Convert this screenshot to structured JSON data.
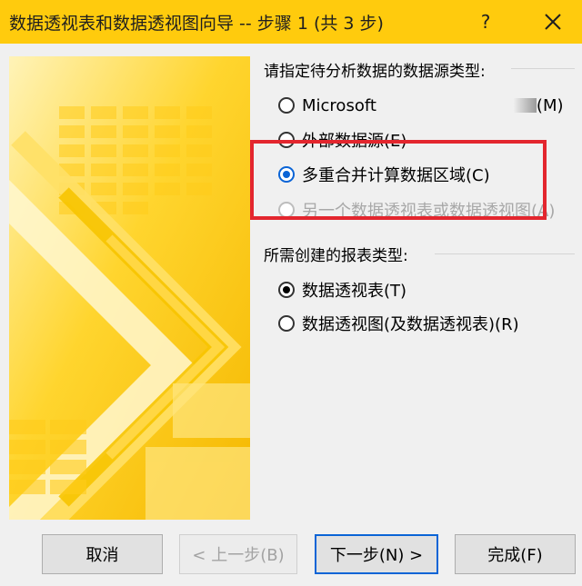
{
  "window": {
    "title": "数据透视表和数据透视图向导 -- 步骤 1 (共 3 步)",
    "help_label": "?",
    "close_icon": "close-icon",
    "titlebar_color": "#ffcb0d"
  },
  "source_group": {
    "label": "请指定待分析数据的数据源类型:",
    "options": [
      {
        "label": "Microsoft",
        "suffix": "(M)",
        "checked": false,
        "enabled": true
      },
      {
        "label": "外部数据源(E)",
        "checked": false,
        "enabled": true
      },
      {
        "label": "多重合并计算数据区域(C)",
        "checked": true,
        "enabled": true
      },
      {
        "label": "另一个数据透视表或数据透视图(A)",
        "checked": false,
        "enabled": false
      }
    ]
  },
  "report_group": {
    "label": "所需创建的报表类型:",
    "options": [
      {
        "label": "数据透视表(T)",
        "checked": true
      },
      {
        "label": "数据透视图(及数据透视表)(R)",
        "checked": false
      }
    ]
  },
  "buttons": {
    "cancel": "取消",
    "back": "< 上一步(B)",
    "next": "下一步(N) >",
    "finish": "完成(F)"
  },
  "accent_colors": {
    "highlight_box": "#e3262e",
    "selected_radio": "#0a64d6"
  }
}
